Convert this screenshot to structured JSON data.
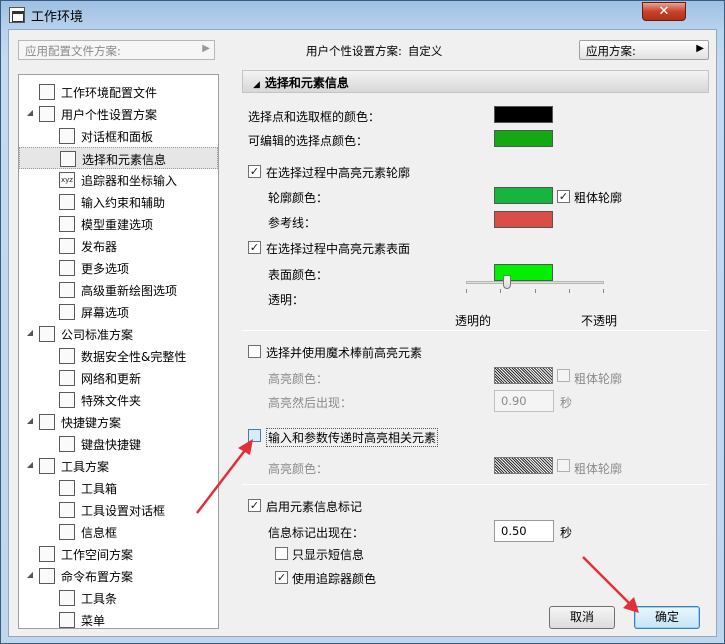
{
  "window": {
    "title": "工作环境",
    "close_glyph": "✕"
  },
  "topbar": {
    "profile_scheme_placeholder": "应用配置文件方案:",
    "personal_scheme_label": "用户个性设置方案:",
    "personal_scheme_value": "自定义",
    "apply_scheme_label": "应用方案:",
    "arrow": "▶"
  },
  "tree": [
    {
      "label": "工作环境配置文件",
      "level": 0,
      "icon": "profile-icon"
    },
    {
      "label": "用户个性设置方案",
      "level": 0,
      "icon": "user-scheme-icon",
      "expanded": true
    },
    {
      "label": "对话框和面板",
      "level": 1,
      "icon": "dialog-panel-icon"
    },
    {
      "label": "选择和元素信息",
      "level": 1,
      "icon": "selection-info-icon",
      "selected": true
    },
    {
      "label": "追踪器和坐标输入",
      "level": 1,
      "icon": "tracker-xyz-icon"
    },
    {
      "label": "输入约束和辅助",
      "level": 1,
      "icon": "input-constraint-icon"
    },
    {
      "label": "模型重建选项",
      "level": 1,
      "icon": "model-rebuild-icon"
    },
    {
      "label": "发布器",
      "level": 1,
      "icon": "publisher-icon"
    },
    {
      "label": "更多选项",
      "level": 1,
      "icon": "more-options-icon"
    },
    {
      "label": "高级重新绘图选项",
      "level": 1,
      "icon": "redraw-icon"
    },
    {
      "label": "屏幕选项",
      "level": 1,
      "icon": "screen-icon"
    },
    {
      "label": "公司标准方案",
      "level": 0,
      "icon": "company-scheme-icon",
      "expanded": true
    },
    {
      "label": "数据安全性&完整性",
      "level": 1,
      "icon": "data-safety-icon"
    },
    {
      "label": "网络和更新",
      "level": 1,
      "icon": "network-icon"
    },
    {
      "label": "特殊文件夹",
      "level": 1,
      "icon": "folder-icon"
    },
    {
      "label": "快捷键方案",
      "level": 0,
      "icon": "shortcut-scheme-icon",
      "expanded": true
    },
    {
      "label": "键盘快捷键",
      "level": 1,
      "icon": "keyboard-icon"
    },
    {
      "label": "工具方案",
      "level": 0,
      "icon": "tool-scheme-icon",
      "expanded": true
    },
    {
      "label": "工具箱",
      "level": 1,
      "icon": "toolbox-icon"
    },
    {
      "label": "工具设置对话框",
      "level": 1,
      "icon": "tool-settings-icon"
    },
    {
      "label": "信息框",
      "level": 1,
      "icon": "info-box-icon"
    },
    {
      "label": "工作空间方案",
      "level": 0,
      "icon": "workspace-icon"
    },
    {
      "label": "命令布置方案",
      "level": 0,
      "icon": "command-layout-icon",
      "expanded": true
    },
    {
      "label": "工具条",
      "level": 1,
      "icon": "toolbar-icon"
    },
    {
      "label": "菜单",
      "level": 1,
      "icon": "menu-icon"
    }
  ],
  "panel": {
    "header": "选择和元素信息",
    "selection_point_color_label": "选择点和选取框的颜色：",
    "editable_point_color_label": "可编辑的选择点颜色：",
    "highlight_contour_label": "在选择过程中高亮元素轮廓",
    "contour_color_label": "轮廓颜色：",
    "bold_contour_label": "粗体轮廓",
    "reference_line_label": "参考线：",
    "highlight_surface_label": "在选择过程中高亮元素表面",
    "surface_color_label": "表面颜色：",
    "transparency_label": "透明：",
    "transparency_fraction": 0.3,
    "transparent_label": "透明的",
    "opaque_label": "不透明",
    "magic_wand_label": "选择并使用魔术棒前高亮元素",
    "mw_highlight_color_label": "高亮颜色：",
    "mw_bold_contour_label": "粗体轮廓",
    "mw_delay_label": "高亮然后出现：",
    "mw_delay_value": "0.90",
    "seconds_unit": "秒",
    "param_transfer_label": "输入和参数传递时高亮相关元素",
    "pt_highlight_color_label": "高亮颜色：",
    "pt_bold_contour_label": "粗体轮廓",
    "enable_info_tag_label": "启用元素信息标记",
    "info_tag_delay_label": "信息标记出现在：",
    "info_tag_delay_value": "0.50",
    "info_tag_unit": "秒",
    "short_info_only_label": "只显示短信息",
    "tracker_colors_label": "使用追踪器颜色",
    "check": "✓"
  },
  "colors": {
    "selection_point": "#000000",
    "editable_point": "#14a814",
    "contour": "#16b53f",
    "reference_line": "#d94e48",
    "surface": "#00f000",
    "annotation_arrow": "#e0303a"
  },
  "buttons": {
    "cancel": "取消",
    "ok": "确定"
  }
}
